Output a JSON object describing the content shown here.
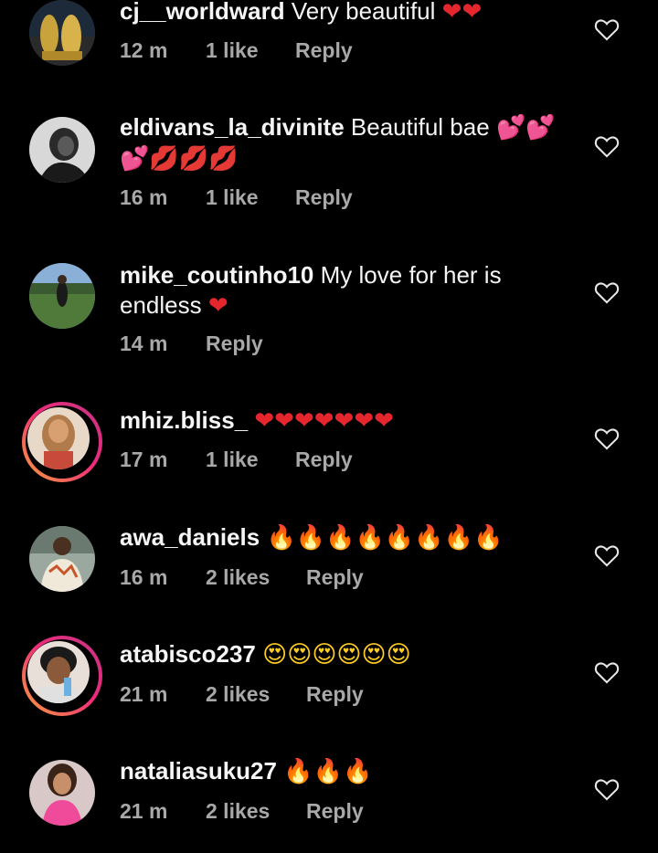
{
  "comments": [
    {
      "username": "cj__worldward",
      "text": "Very beautiful",
      "emoji": "❤❤",
      "time": "12 m",
      "likes": "1 like",
      "reply": "Reply",
      "story_ring": false
    },
    {
      "username": "eldivans_la_divinite",
      "text": "Beautiful bae",
      "emoji": "💕💕",
      "emoji2": "💕💋💋💋",
      "time": "16 m",
      "likes": "1 like",
      "reply": "Reply",
      "story_ring": false
    },
    {
      "username": "mike_coutinho10",
      "text": "My love for her is",
      "text2": "endless",
      "emoji": "❤",
      "time": "14 m",
      "likes": "",
      "reply": "Reply",
      "story_ring": false
    },
    {
      "username": "mhiz.bliss_",
      "text": "",
      "emoji": "❤❤❤❤❤❤❤",
      "time": "17 m",
      "likes": "1 like",
      "reply": "Reply",
      "story_ring": true
    },
    {
      "username": "awa_daniels",
      "text": "",
      "emoji": "🔥🔥🔥🔥🔥🔥🔥🔥",
      "time": "16 m",
      "likes": "2 likes",
      "reply": "Reply",
      "story_ring": false
    },
    {
      "username": "atabisco237",
      "text": "",
      "emoji": "😍😍😍😍😍😍",
      "time": "21 m",
      "likes": "2 likes",
      "reply": "Reply",
      "story_ring": true
    },
    {
      "username": "nataliasuku27",
      "text": "",
      "emoji": "🔥🔥🔥",
      "time": "21 m",
      "likes": "2 likes",
      "reply": "Reply",
      "story_ring": false
    }
  ],
  "colors": {
    "background": "#000000",
    "text": "#f5f5f5",
    "meta": "#a8a8a8",
    "heart_red": "#e5262d",
    "story_ring": "#ee2a7b"
  },
  "icons": {
    "like": "heart-outline-icon"
  }
}
